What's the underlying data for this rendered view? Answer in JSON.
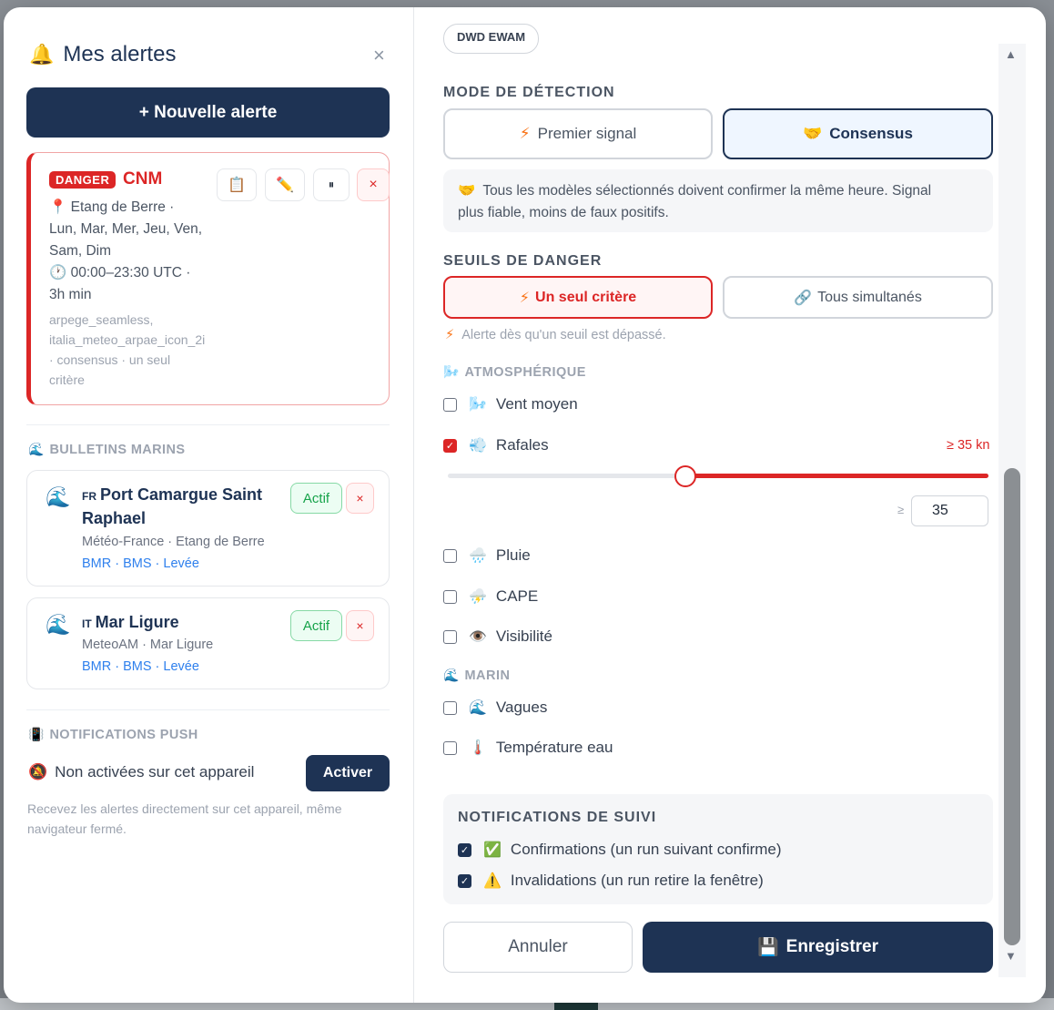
{
  "left": {
    "title_icon": "🔔",
    "title": "Mes alertes",
    "close": "×",
    "new_alert": "+ Nouvelle alerte",
    "alert": {
      "badge": "DANGER",
      "name": "CNM",
      "location_line1": "📍 Etang de Berre ·",
      "days_line1": "Lun, Mar, Mer, Jeu, Ven,",
      "days_line2": "Sam, Dim",
      "time_line": "🕐 00:00–23:30 UTC ·",
      "duration": "3h min",
      "meta_line1": "arpege_seamless,",
      "meta_line2": "italia_meteo_arpae_icon_2i",
      "meta_line3": "· consensus · un seul",
      "meta_line4": "critère",
      "btn_copy": "📋",
      "btn_edit": "✏️",
      "btn_pause": "⏸",
      "btn_delete": "×"
    },
    "bulletins": {
      "icon": "🌊",
      "head": "BULLETINS MARINS",
      "items": [
        {
          "flag": "FR",
          "title_line1": "Port Camargue Saint",
          "title_line2": "Raphael",
          "sub": "Météo-France · Etang de Berre",
          "links": "BMR · BMS · Levée",
          "status": "Actif",
          "delete": "×"
        },
        {
          "flag": "IT",
          "title_line1": "Mar Ligure",
          "sub": "MeteoAM · Mar Ligure",
          "links": "BMR · BMS · Levée",
          "status": "Actif",
          "delete": "×"
        }
      ]
    },
    "push": {
      "icon": "📳",
      "head": "NOTIFICATIONS PUSH",
      "status_icon": "🔕",
      "status": "Non activées sur cet appareil",
      "activate": "Activer",
      "note_line1": "Recevez les alertes directement sur cet appareil, même",
      "note_line2": "navigateur fermé."
    }
  },
  "right": {
    "model_chip": "DWD EWAM",
    "mode": {
      "head": "MODE DE DÉTECTION",
      "option1_icon": "⚡",
      "option1": "Premier signal",
      "option2_icon": "🤝",
      "option2": "Consensus",
      "selected": "Consensus",
      "info_icon": "🤝",
      "info_line1": "Tous les modèles sélectionnés doivent confirmer la même heure. Signal",
      "info_line2": "plus fiable, moins de faux positifs."
    },
    "seuils": {
      "head": "SEUILS DE DANGER",
      "option1_icon": "⚡",
      "option1": "Un seul critère",
      "option2_icon": "🔗",
      "option2": "Tous simultanés",
      "selected": "Un seul critère",
      "hint_icon": "⚡",
      "hint": "Alerte dès qu'un seuil est dépassé."
    },
    "atmos": {
      "icon": "🌬️",
      "head": "ATMOSPHÉRIQUE",
      "items": [
        {
          "icon": "🌬️",
          "label": "Vent moyen",
          "checked": false
        },
        {
          "icon": "💨",
          "label": "Rafales",
          "checked": true,
          "threshold": "≥ 35 kn",
          "value": "35",
          "prefix": "≥",
          "slider_fraction": 0.44
        },
        {
          "icon": "🌧️",
          "label": "Pluie",
          "checked": false
        },
        {
          "icon": "⛈️",
          "label": "CAPE",
          "checked": false
        },
        {
          "icon": "👁️",
          "label": "Visibilité",
          "checked": false
        }
      ]
    },
    "marin": {
      "icon": "🌊",
      "head": "MARIN",
      "items": [
        {
          "icon": "🌊",
          "label": "Vagues",
          "checked": false
        },
        {
          "icon": "🌡️",
          "label": "Température eau",
          "checked": false
        }
      ]
    },
    "follow": {
      "head": "NOTIFICATIONS DE SUIVI",
      "item1_icon": "✅",
      "item1": "Confirmations (un run suivant confirme)",
      "item1_checked": true,
      "item2_icon": "⚠️",
      "item2": "Invalidations (un run retire la fenêtre)",
      "item2_checked": true
    },
    "cancel": "Annuler",
    "save_icon": "💾",
    "save": "Enregistrer"
  },
  "colors": {
    "navy": "#1e3354",
    "danger": "#dc2626",
    "success": "#16a34a",
    "link": "#2f80ed"
  }
}
